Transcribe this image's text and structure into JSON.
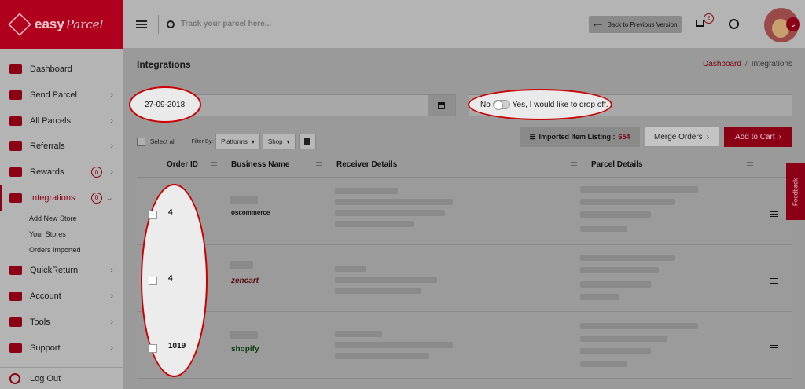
{
  "brand": {
    "name": "easy",
    "name_script": "Parcel"
  },
  "header": {
    "search_placeholder": "Track your parcel here...",
    "back_button": "Back to Previous Version",
    "cart_count": "2"
  },
  "sidebar": {
    "items": [
      {
        "label": "Dashboard"
      },
      {
        "label": "Send Parcel"
      },
      {
        "label": "All Parcels"
      },
      {
        "label": "Referrals"
      },
      {
        "label": "Rewards",
        "badge": "0"
      },
      {
        "label": "Integrations",
        "badge": "0"
      },
      {
        "label": "QuickReturn"
      },
      {
        "label": "Account"
      },
      {
        "label": "Tools"
      },
      {
        "label": "Support"
      }
    ],
    "subitems": [
      "Add New Store",
      "Your Stores",
      "Orders Imported"
    ],
    "logout": "Log Out"
  },
  "page": {
    "title": "Integrations",
    "breadcrumb_home": "Dashboard",
    "breadcrumb_current": "Integrations"
  },
  "form": {
    "date_value": "27-09-2018",
    "toggle_off": "No",
    "toggle_on": "Yes, I would like to drop off."
  },
  "toolbar": {
    "select_all": "Select all",
    "filter_by": "Filter By:",
    "platforms": "Platforms",
    "shop": "Shop",
    "imported_label": "Imported Item Listing :",
    "imported_count": "654",
    "merge_orders": "Merge Orders",
    "add_to_cart": "Add to Cart"
  },
  "table": {
    "columns": [
      "Order ID",
      "Business Name",
      "Receiver Details",
      "Parcel Details"
    ],
    "rows": [
      {
        "order_id": "4",
        "platform": "oscommerce"
      },
      {
        "order_id": "4",
        "platform": "zencart"
      },
      {
        "order_id": "1019",
        "platform": "shopify"
      }
    ]
  },
  "feedback": "Feedback",
  "colors": {
    "brand": "#b0001e",
    "highlight_outline": "#cc0000"
  }
}
